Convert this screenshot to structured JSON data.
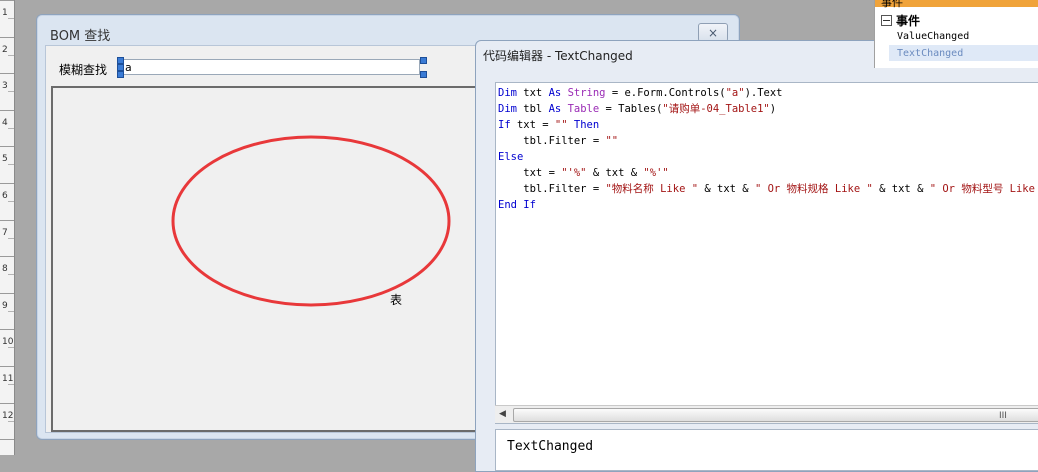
{
  "ruler": {
    "numbers": [
      "1",
      "2",
      "3",
      "4",
      "5",
      "6",
      "7",
      "8",
      "9",
      "10",
      "11",
      "12"
    ]
  },
  "form": {
    "title": "BOM  查找",
    "close_icon": "×",
    "search_label": "模糊查找",
    "search_value": "a",
    "table_label": "表"
  },
  "editor": {
    "title": "代码编辑器 - TextChanged",
    "code_lines": [
      [
        {
          "t": "Dim",
          "c": "kw"
        },
        {
          "t": " txt "
        },
        {
          "t": "As",
          "c": "kw"
        },
        {
          "t": " "
        },
        {
          "t": "String",
          "c": "ty"
        },
        {
          "t": " = e.Form.Controls("
        },
        {
          "t": "\"a\"",
          "c": "st"
        },
        {
          "t": ").Text"
        }
      ],
      [
        {
          "t": "Dim",
          "c": "kw"
        },
        {
          "t": " tbl "
        },
        {
          "t": "As",
          "c": "kw"
        },
        {
          "t": " "
        },
        {
          "t": "Table",
          "c": "ty"
        },
        {
          "t": " = Tables("
        },
        {
          "t": "\"请购单-04_Table1\"",
          "c": "st"
        },
        {
          "t": ")"
        }
      ],
      [
        {
          "t": "If",
          "c": "kw"
        },
        {
          "t": " txt = "
        },
        {
          "t": "\"\"",
          "c": "st"
        },
        {
          "t": " "
        },
        {
          "t": "Then",
          "c": "kw"
        }
      ],
      [
        {
          "t": "    tbl.Filter = "
        },
        {
          "t": "\"\"",
          "c": "st"
        }
      ],
      [
        {
          "t": "Else",
          "c": "kw"
        }
      ],
      [
        {
          "t": "    txt = "
        },
        {
          "t": "\"'%\"",
          "c": "st"
        },
        {
          "t": " & txt & "
        },
        {
          "t": "\"%'\"",
          "c": "st"
        }
      ],
      [
        {
          "t": "    tbl.Filter = "
        },
        {
          "t": "\"物料名称 Like \"",
          "c": "st"
        },
        {
          "t": " & txt & "
        },
        {
          "t": "\" Or 物料规格 Like \"",
          "c": "st"
        },
        {
          "t": " & txt & "
        },
        {
          "t": "\" Or 物料型号 Like",
          "c": "st"
        }
      ],
      [
        {
          "t": "End If",
          "c": "kw"
        }
      ]
    ],
    "scroll_left_icon": "◀",
    "scroll_grip": "III",
    "bottom_text": "TextChanged"
  },
  "events_panel": {
    "header": "事件",
    "category": "事件",
    "items": [
      "ValueChanged",
      "TextChanged"
    ]
  },
  "colors": {
    "keyword": "#0000d0",
    "type": "#9a2bb5",
    "string": "#a31515",
    "annotation_ellipse": "#e8383a",
    "events_header": "#f0a33a"
  }
}
